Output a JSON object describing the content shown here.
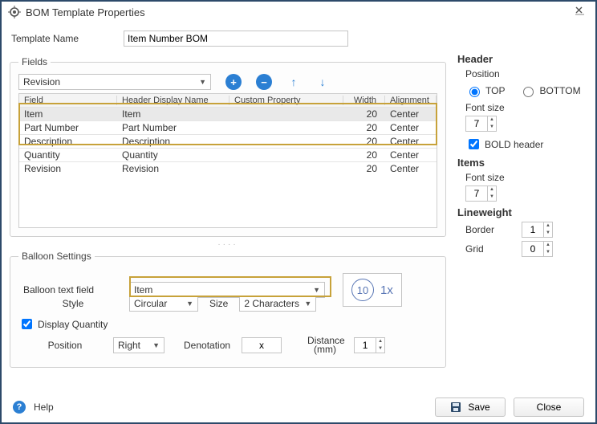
{
  "window": {
    "title": "BOM Template Properties",
    "close_label": "✕"
  },
  "template_name": {
    "label": "Template Name",
    "value": "Item Number BOM"
  },
  "fields_section": {
    "legend": "Fields",
    "field_selector": "Revision",
    "columns": {
      "c1": "Field",
      "c2": "Header Display Name",
      "c3": "Custom Property",
      "c4": "Width",
      "c5": "Alignment"
    },
    "rows": [
      {
        "field": "Item",
        "display": "Item",
        "width": "20",
        "align": "Center"
      },
      {
        "field": "Part Number",
        "display": "Part Number",
        "width": "20",
        "align": "Center"
      },
      {
        "field": "Description",
        "display": "Description",
        "width": "20",
        "align": "Center"
      },
      {
        "field": "Quantity",
        "display": "Quantity",
        "width": "20",
        "align": "Center"
      },
      {
        "field": "Revision",
        "display": "Revision",
        "width": "20",
        "align": "Center"
      }
    ]
  },
  "balloon": {
    "legend": "Balloon Settings",
    "text_field_label": "Balloon text field",
    "text_field_value": "Item",
    "style_label": "Style",
    "style_value": "Circular",
    "size_label": "Size",
    "size_value": "2 Characters",
    "display_qty_label": "Display Quantity",
    "position_label": "Position",
    "position_value": "Right",
    "denotation_label": "Denotation",
    "denotation_value": "x",
    "distance_label": "Distance (mm)",
    "distance_value": "1",
    "preview_num": "10",
    "preview_txt": "1x"
  },
  "right": {
    "header_title": "Header",
    "position_label": "Position",
    "top_label": "TOP",
    "bottom_label": "BOTTOM",
    "font_size_label": "Font size",
    "header_font_size": "7",
    "bold_label": "BOLD header",
    "items_title": "Items",
    "items_font_size": "7",
    "lineweight_title": "Lineweight",
    "border_label": "Border",
    "border_value": "1",
    "grid_label": "Grid",
    "grid_value": "0"
  },
  "footer": {
    "help_label": "Help",
    "save_label": "Save",
    "close_label": "Close"
  }
}
